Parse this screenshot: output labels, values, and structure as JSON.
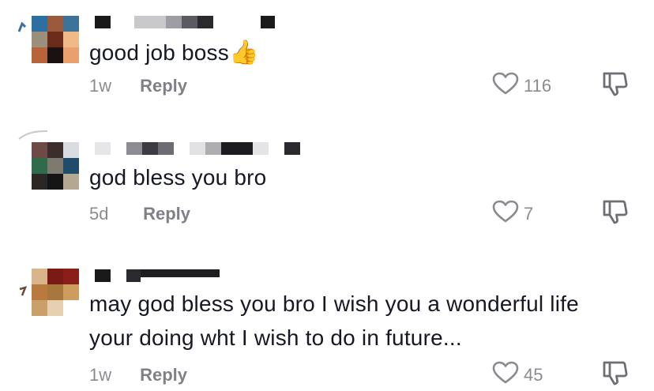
{
  "comments": [
    {
      "text": "good job boss",
      "emoji": "👍",
      "time": "1w",
      "reply_label": "Reply",
      "likes": "116"
    },
    {
      "text": "god bless you bro",
      "time": "5d",
      "reply_label": "Reply",
      "likes": "7"
    },
    {
      "text_line1": "may god bless you bro I wish you a wonderful life",
      "text_line2": "your doing wht I wish to do in future...",
      "time": "1w",
      "reply_label": "Reply",
      "likes": "45"
    }
  ],
  "icons": {
    "like": "heart-icon",
    "dislike": "thumbs-down-icon",
    "avatar": "pixelated-avatar"
  },
  "colors": {
    "text": "#161823",
    "muted": "rgba(22,24,35,0.5)"
  }
}
